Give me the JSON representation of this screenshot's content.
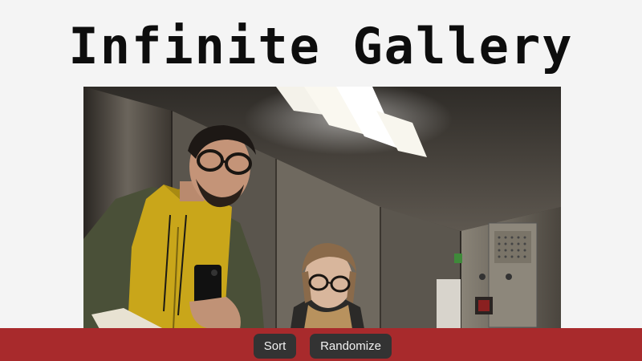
{
  "header": {
    "title": "Infinite Gallery"
  },
  "gallery": {
    "current_image_alt": "selfie-in-elevator-mirror"
  },
  "toolbar": {
    "sort_label": "Sort",
    "randomize_label": "Randomize"
  },
  "colors": {
    "page_background": "#f4f4f4",
    "bottom_bar": "#a82a2c",
    "button_background": "#333333",
    "button_text": "#f2f2f2"
  }
}
